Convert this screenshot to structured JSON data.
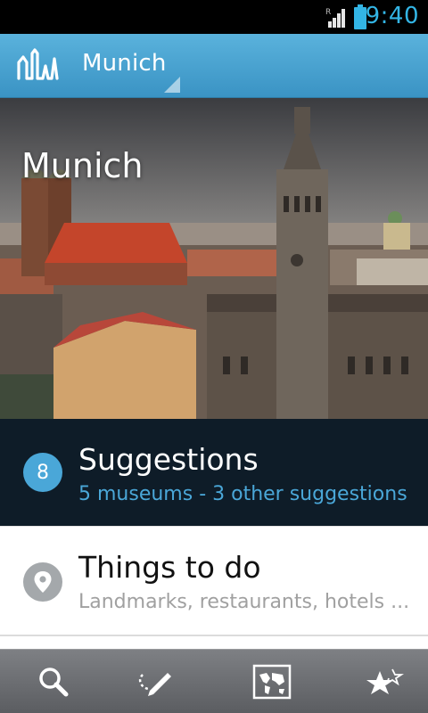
{
  "status_bar": {
    "time": "9:40",
    "signal_icon": "signal-roaming-icon",
    "battery_icon": "battery-icon",
    "accent_color": "#33b5e5"
  },
  "action_bar": {
    "logo_icon": "city-skyline-logo-icon",
    "city_label": "Munich",
    "background_color": "#4aa7d8"
  },
  "hero": {
    "title": "Munich",
    "image_description_icon": "munich-city-photo"
  },
  "rows": {
    "suggestions": {
      "count": "8",
      "title": "Suggestions",
      "subtitle": "5 museums - 3 other suggestions"
    },
    "things_to_do": {
      "icon": "location-pin-icon",
      "title": "Things to do",
      "subtitle": "Landmarks, restaurants, hotels ..."
    }
  },
  "toolbar": {
    "items": [
      {
        "icon": "search-icon"
      },
      {
        "icon": "draw-route-icon"
      },
      {
        "icon": "world-map-icon"
      },
      {
        "icon": "favorites-stars-icon"
      }
    ]
  }
}
